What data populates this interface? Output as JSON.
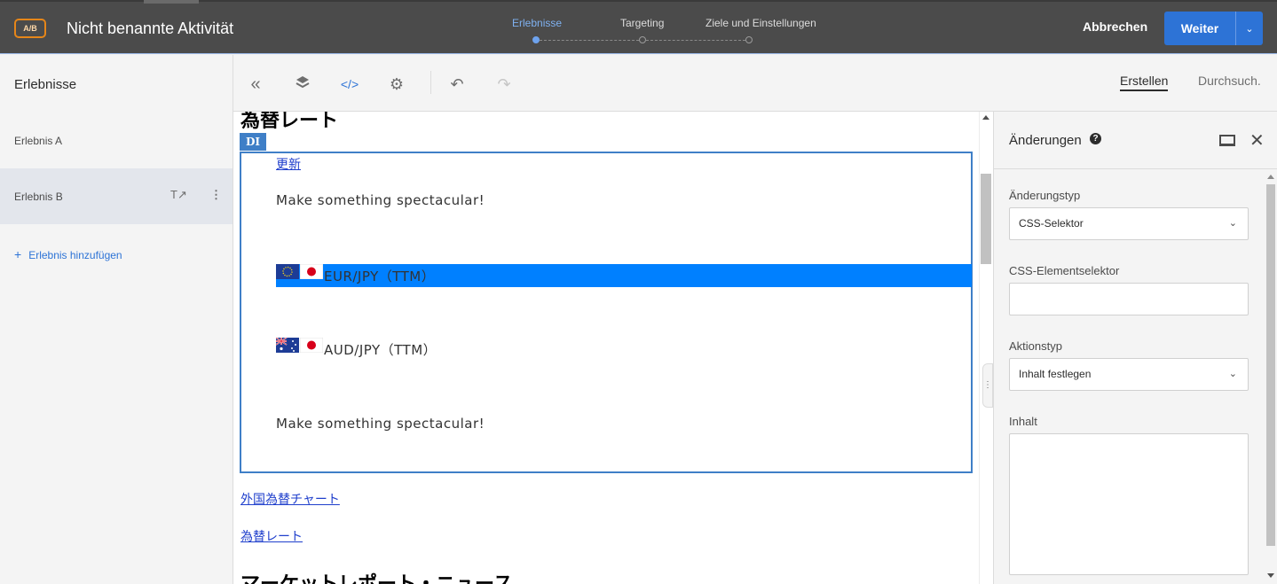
{
  "header": {
    "badge": "A/B",
    "title": "Nicht benannte Aktivität",
    "steps": [
      {
        "label": "Erlebnisse",
        "active": true
      },
      {
        "label": "Targeting",
        "active": false
      },
      {
        "label": "Ziele und Einstellungen",
        "active": false
      }
    ],
    "cancel_label": "Abbrechen",
    "next_label": "Weiter"
  },
  "sidebar": {
    "title": "Erlebnisse",
    "items": [
      {
        "label": "Erlebnis A",
        "selected": false
      },
      {
        "label": "Erlebnis B",
        "selected": true
      }
    ],
    "add_label": "Erlebnis hinzufügen"
  },
  "toolbar": {
    "icons": [
      "collapse-icon",
      "layers-icon",
      "code-icon",
      "settings-icon",
      "undo-icon",
      "redo-icon"
    ],
    "tabs": [
      "Erstellen",
      "Durchsuch."
    ]
  },
  "canvas": {
    "heading_top": "為替レート",
    "tag": "DI",
    "update_link": "更新",
    "tagline_1": "Make something spectacular!",
    "rate_1": "EUR/JPY（TTM）",
    "rate_2": "AUD/JPY（TTM）",
    "tagline_2": "Make something spectacular!",
    "link_chart": "外国為替チャート",
    "link_rates": "為替レート",
    "heading_bottom": "マーケットレポート・ニュース"
  },
  "panel": {
    "title": "Änderungen",
    "change_type_label": "Änderungstyp",
    "change_type_value": "CSS-Selektor",
    "selector_label": "CSS-Elementselektor",
    "selector_value": "",
    "action_label": "Aktionstyp",
    "action_value": "Inhalt festlegen",
    "content_label": "Inhalt",
    "content_value": ""
  },
  "colors": {
    "topbar": "#4b4b4b",
    "accent": "#2d73d6",
    "badge": "#e68619",
    "highlight_row": "#0080ff"
  }
}
